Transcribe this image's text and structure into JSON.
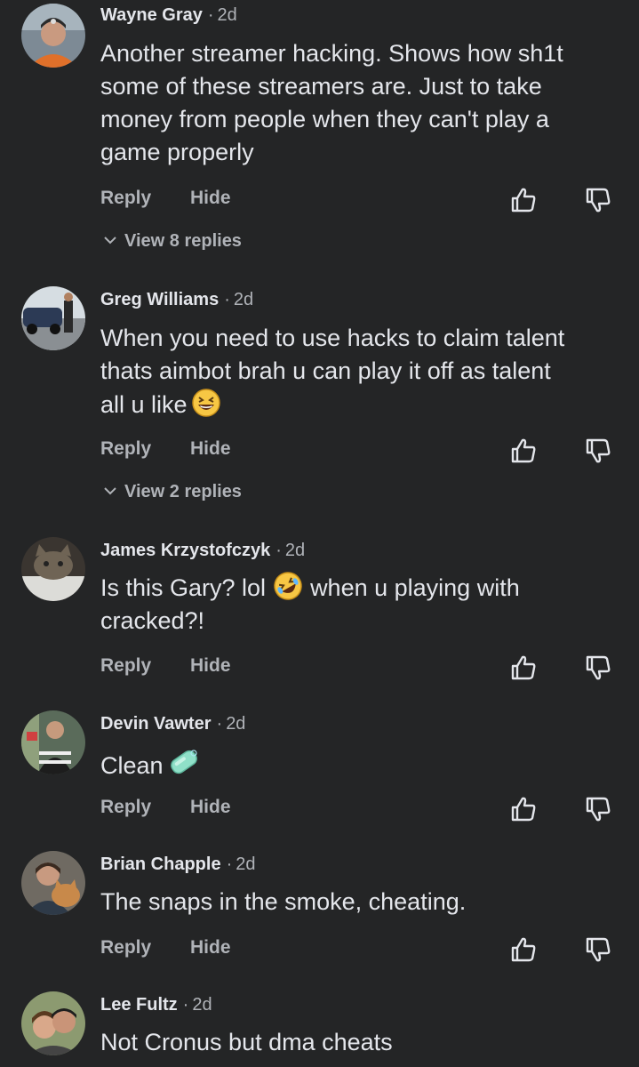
{
  "comments": [
    {
      "author": "Wayne Gray",
      "time": "2d",
      "lines": [
        "Another streamer hacking. Shows how sh1t",
        "some of these streamers are.  Just to take",
        "money from people when they can't play a",
        "game properly"
      ],
      "reply_label": "Reply",
      "hide_label": "Hide",
      "view_replies": "View 8 replies"
    },
    {
      "author": "Greg Williams",
      "time": "2d",
      "lines": [
        "When you need to use hacks to claim talent",
        "thats aimbot brah u can play it off as talent",
        "all u like"
      ],
      "emoji": "grinning-squinting-face-emoji",
      "reply_label": "Reply",
      "hide_label": "Hide",
      "view_replies": "View 2 replies"
    },
    {
      "author": "James Krzystofczyk",
      "time": "2d",
      "line1_a": "Is this Gary? lol",
      "line1_b": "when u playing with",
      "line2": "cracked?!",
      "emoji": "rolling-on-floor-laughing-emoji",
      "reply_label": "Reply",
      "hide_label": "Hide"
    },
    {
      "author": "Devin Vawter",
      "time": "2d",
      "text": "Clean",
      "emoji": "soap-emoji",
      "reply_label": "Reply",
      "hide_label": "Hide"
    },
    {
      "author": "Brian Chapple",
      "time": "2d",
      "text": "The snaps in the smoke, cheating.",
      "reply_label": "Reply",
      "hide_label": "Hide"
    },
    {
      "author": "Lee Fultz",
      "time": "2d",
      "text": "Not Cronus but dma cheats"
    }
  ],
  "separator": "·",
  "icons": {
    "like": "thumbs-up-icon",
    "dislike": "thumbs-down-icon",
    "expand": "chevron-down-icon"
  },
  "colors": {
    "background": "#242526",
    "primary_text": "#e4e6eb",
    "secondary_text": "#b0b3b8"
  }
}
